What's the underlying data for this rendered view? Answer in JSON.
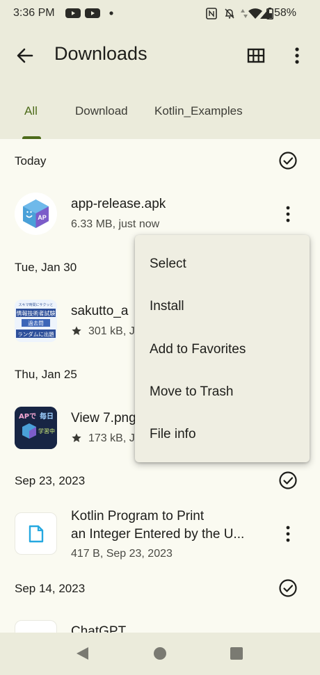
{
  "status_bar": {
    "time": "3:36 PM",
    "battery_percent": "58%"
  },
  "app_bar": {
    "title": "Downloads",
    "back_icon": "arrow-back-icon",
    "grid_icon": "grid-view-icon",
    "more_icon": "more-vert-icon"
  },
  "tabs": [
    {
      "label": "All",
      "active": true
    },
    {
      "label": "Download",
      "active": false
    },
    {
      "label": "Kotlin_Examples",
      "active": false
    }
  ],
  "sections": [
    {
      "heading": "Today",
      "files": [
        {
          "name": "app-release.apk",
          "meta": "6.33 MB, just now",
          "starred": false
        }
      ]
    },
    {
      "heading": "Tue, Jan 30",
      "files": [
        {
          "name": "sakutto_a",
          "meta": "301 kB, J",
          "starred": true
        }
      ]
    },
    {
      "heading": "Thu, Jan 25",
      "files": [
        {
          "name": "View 7.png",
          "meta": "173 kB, J",
          "starred": true
        }
      ]
    },
    {
      "heading": "Sep 23, 2023",
      "files": [
        {
          "name_line1": "Kotlin Program to Print",
          "name_line2": "an Integer Entered by the U...",
          "meta": "417 B, Sep 23, 2023",
          "starred": false
        }
      ]
    },
    {
      "heading": "Sep 14, 2023",
      "files": [
        {
          "name": "ChatGPT",
          "meta": "",
          "starred": false
        }
      ]
    }
  ],
  "thumb_text": {
    "sakutto_l1": "スキマ時間にサクッと",
    "sakutto_l2": "情報技術者試験",
    "sakutto_l3": "過去問",
    "sakutto_l4": "ランダムに出題",
    "view_l1": "APで",
    "view_l2": "毎日",
    "view_l3": "学習中",
    "logo": "AP"
  },
  "context_menu": {
    "items": [
      "Select",
      "Install",
      "Add to Favorites",
      "Move to Trash",
      "File info"
    ]
  },
  "nav_bar": {
    "back": "nav-back-icon",
    "home": "nav-home-icon",
    "recents": "nav-recents-icon"
  },
  "colors": {
    "accent": "#4d6b1a",
    "surface": "#ebebdb",
    "background": "#fafaf1",
    "menu": "#efeee2"
  }
}
